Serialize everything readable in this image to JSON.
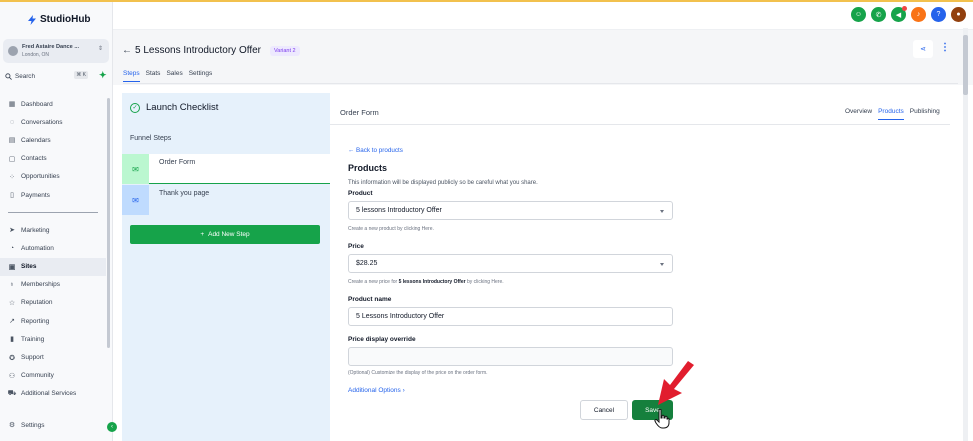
{
  "brand": {
    "name": "StudioHub",
    "accent": "#16a34a"
  },
  "account": {
    "name": "Fred Astaire Dance ...",
    "location": "London, ON"
  },
  "search": {
    "label": "Search",
    "shortcut": "⌘ K"
  },
  "nav": {
    "group1": [
      {
        "label": "Dashboard",
        "icon": "grid-icon"
      },
      {
        "label": "Conversations",
        "icon": "chat-bubble-icon"
      },
      {
        "label": "Calendars",
        "icon": "calendar-icon"
      },
      {
        "label": "Contacts",
        "icon": "contacts-icon"
      },
      {
        "label": "Opportunities",
        "icon": "opportunities-icon"
      },
      {
        "label": "Payments",
        "icon": "payments-icon"
      }
    ],
    "group2": [
      {
        "label": "Marketing",
        "icon": "send-icon"
      },
      {
        "label": "Automation",
        "icon": "automation-icon"
      },
      {
        "label": "Sites",
        "icon": "sites-icon",
        "active": true
      },
      {
        "label": "Memberships",
        "icon": "memberships-icon"
      },
      {
        "label": "Reputation",
        "icon": "star-icon"
      },
      {
        "label": "Reporting",
        "icon": "trend-icon"
      },
      {
        "label": "Training",
        "icon": "book-icon"
      },
      {
        "label": "Support",
        "icon": "support-icon"
      },
      {
        "label": "Community",
        "icon": "community-icon"
      },
      {
        "label": "Additional Services",
        "icon": "cart-icon"
      }
    ],
    "settings": "Settings"
  },
  "header_icons": [
    {
      "name": "contacts-quick-icon",
      "color": "#16a34a"
    },
    {
      "name": "phone-icon",
      "color": "#16a34a"
    },
    {
      "name": "announcement-icon",
      "color": "#16a34a"
    },
    {
      "name": "bell-icon",
      "color": "#f97316"
    },
    {
      "name": "help-icon",
      "color": "#2563eb"
    },
    {
      "name": "user-avatar-icon",
      "color": "#92400e"
    }
  ],
  "page": {
    "title": "5 Lessons Introductory Offer",
    "variant": "Variant 2",
    "tabs": [
      "Steps",
      "Stats",
      "Sales",
      "Settings"
    ],
    "active_tab": "Steps"
  },
  "checklist": {
    "title": "Launch Checklist",
    "subtitle": "Funnel Steps",
    "steps": [
      "Order Form",
      "Thank you page"
    ],
    "add_step": "Add New Step"
  },
  "panel": {
    "title": "Order Form",
    "tabs": [
      "Overview",
      "Products",
      "Publishing"
    ],
    "active_tab": "Products",
    "back_link": "Back to products",
    "section_title": "Products",
    "section_desc": "This information will be displayed publicly so be careful what you share.",
    "product_label": "Product",
    "product_value": "5 lessons Introductory Offer",
    "product_hint": "Create a new product by clicking Here.",
    "price_label": "Price",
    "price_value": "$28.25",
    "price_hint_before": "Create a new price for ",
    "price_hint_bold": "5 lessons Introductory Offer",
    "price_hint_after": " by clicking Here.",
    "name_label": "Product name",
    "name_value": "5 Lessons Introductory Offer",
    "override_label": "Price display override",
    "override_value": "",
    "override_hint": "(Optional) Customize the display of the price on the order form.",
    "additional_options": "Additional Options",
    "cancel": "Cancel",
    "save": "Save"
  }
}
